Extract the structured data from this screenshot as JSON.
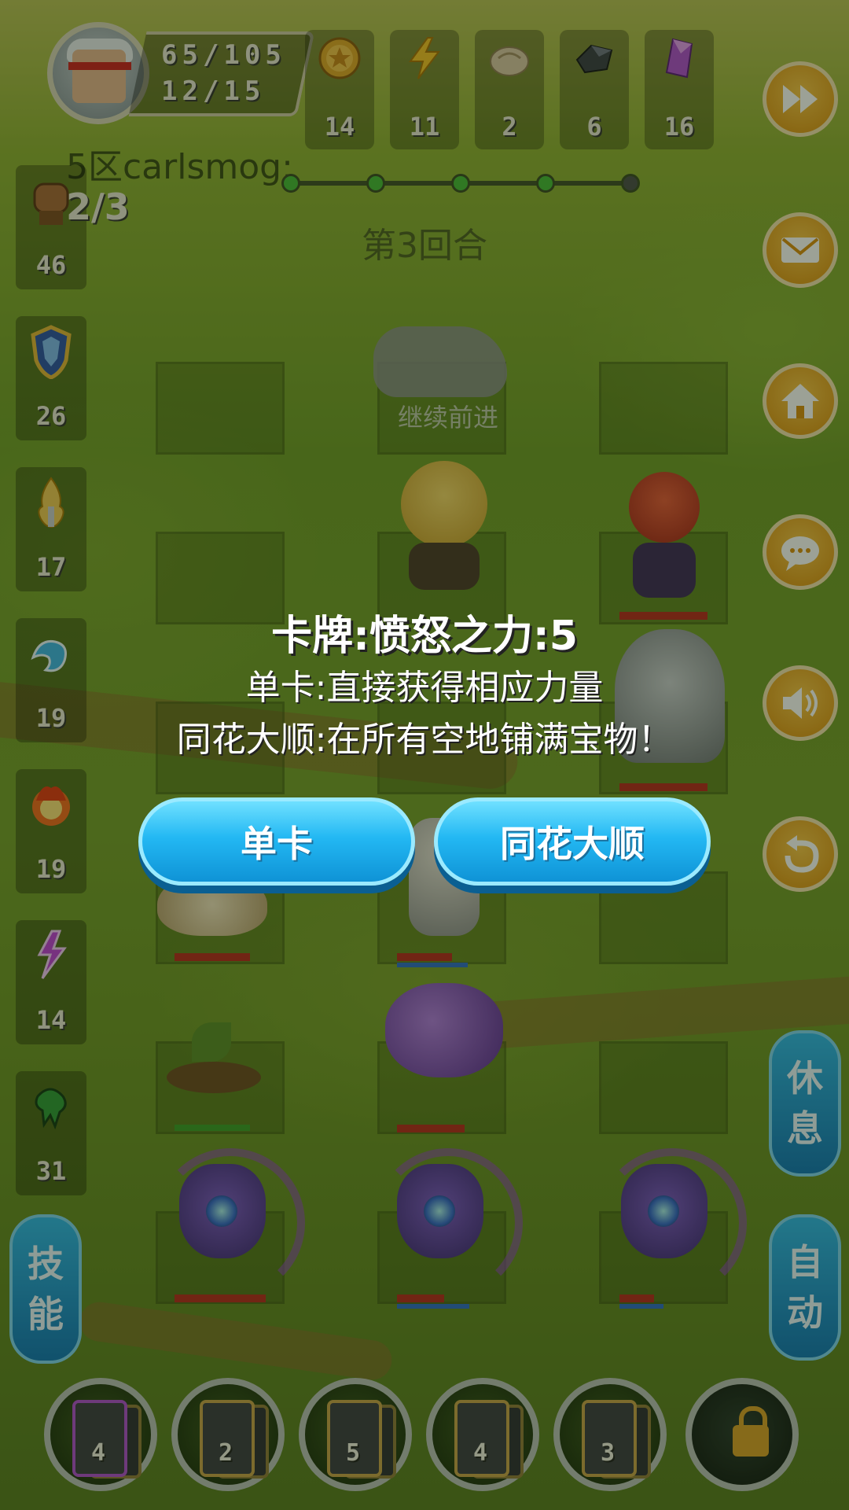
{
  "hud": {
    "stat_top": "65/105",
    "stat_bottom": "12/15",
    "player_name": "5区carlsmog:",
    "round": "第3回合"
  },
  "resources": [
    {
      "icon": "gold-coin-icon",
      "count": "14"
    },
    {
      "icon": "lightning-icon",
      "count": "11"
    },
    {
      "icon": "bun-icon",
      "count": "2"
    },
    {
      "icon": "iron-ore-icon",
      "count": "6"
    },
    {
      "icon": "purple-crystal-icon",
      "count": "16"
    }
  ],
  "progress": {
    "completed": 4,
    "total": 5
  },
  "left_stats": {
    "fist_progress": "2/3",
    "items": [
      {
        "icon": "fist-icon",
        "count": "46"
      },
      {
        "icon": "shield-icon",
        "count": "26"
      },
      {
        "icon": "spirit-flame-icon",
        "count": "17"
      },
      {
        "icon": "water-wave-icon",
        "count": "19"
      },
      {
        "icon": "fire-icon",
        "count": "19"
      },
      {
        "icon": "lightning-rune-icon",
        "count": "14"
      },
      {
        "icon": "poison-drop-icon",
        "count": "31"
      }
    ]
  },
  "right_buttons": [
    {
      "icon": "fast-forward-icon"
    },
    {
      "icon": "mail-icon"
    },
    {
      "icon": "home-icon"
    },
    {
      "icon": "chat-icon"
    },
    {
      "icon": "sound-icon"
    },
    {
      "icon": "return-icon"
    }
  ],
  "board": {
    "continue_label": "继续前进"
  },
  "side_buttons": {
    "skill_1": "技",
    "skill_2": "能",
    "rest_1": "休",
    "rest_2": "息",
    "auto_1": "自",
    "auto_2": "动"
  },
  "dialog": {
    "title": "卡牌:愤怒之力:5",
    "line1": "单卡:直接获得相应力量",
    "line2": "同花大顺:在所有空地铺满宝物！",
    "single_button": "单卡",
    "flush_button": "同花大顺"
  },
  "cards": [
    {
      "count": "4",
      "style": "purple"
    },
    {
      "count": "2",
      "style": "gold"
    },
    {
      "count": "5",
      "style": "gold"
    },
    {
      "count": "4",
      "style": "gold"
    },
    {
      "count": "3",
      "style": "gold"
    }
  ],
  "colors": {
    "accent_orange": "#d88f10",
    "button_blue": "#23b8f3",
    "hp_red": "#b52a1f"
  }
}
